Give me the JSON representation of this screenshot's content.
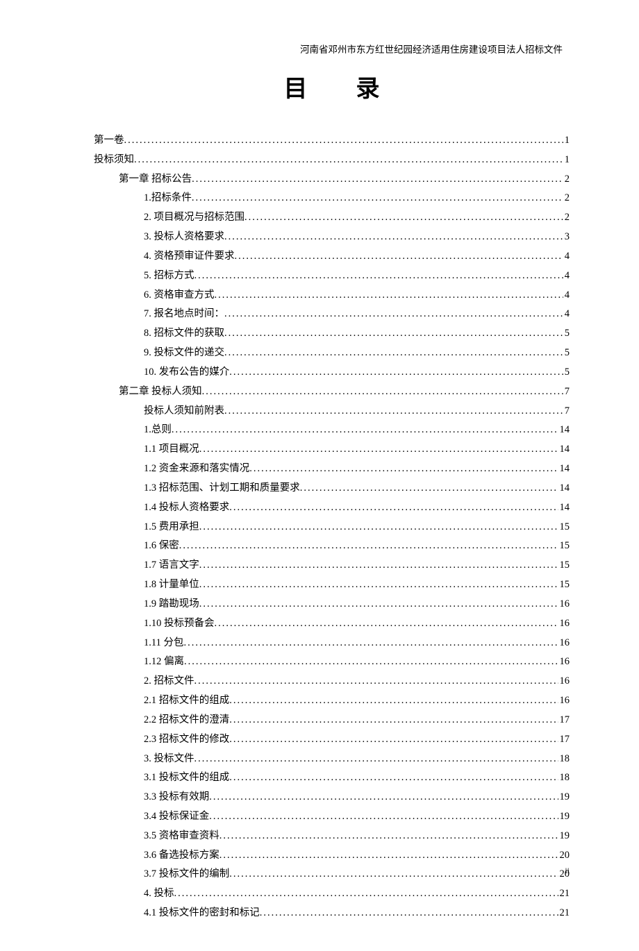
{
  "header": "河南省邓州市东方红世纪园经济适用住房建设项目法人招标文件",
  "title": "目录",
  "footer": "ii",
  "toc": [
    {
      "indent": 0,
      "label": "第一卷",
      "page": "1"
    },
    {
      "indent": 0,
      "label": "投标须知",
      "page": "1"
    },
    {
      "indent": 1,
      "label": "第一章 招标公告",
      "page": "2"
    },
    {
      "indent": 2,
      "label": "1.招标条件",
      "page": "2"
    },
    {
      "indent": 2,
      "label": "2. 项目概况与招标范围",
      "page": "2"
    },
    {
      "indent": 2,
      "label": "3. 投标人资格要求",
      "page": "3"
    },
    {
      "indent": 2,
      "label": "4. 资格预审证件要求",
      "page": "4"
    },
    {
      "indent": 2,
      "label": "5. 招标方式",
      "page": "4"
    },
    {
      "indent": 2,
      "label": "6. 资格审查方式",
      "page": "4"
    },
    {
      "indent": 2,
      "label": "7. 报名地点时间：",
      "page": "4"
    },
    {
      "indent": 2,
      "label": "8. 招标文件的获取",
      "page": "5"
    },
    {
      "indent": 2,
      "label": "9. 投标文件的递交",
      "page": "5"
    },
    {
      "indent": 2,
      "label": "10. 发布公告的媒介",
      "page": "5"
    },
    {
      "indent": 1,
      "label": "第二章 投标人须知",
      "page": "7"
    },
    {
      "indent": 2,
      "label": "投标人须知前附表",
      "page": "7"
    },
    {
      "indent": 2,
      "label": "1.总则",
      "page": "14"
    },
    {
      "indent": 2,
      "label": "1.1 项目概况",
      "page": "14"
    },
    {
      "indent": 2,
      "label": "1.2 资金来源和落实情况",
      "page": "14"
    },
    {
      "indent": 2,
      "label": "1.3 招标范围、计划工期和质量要求",
      "page": "14"
    },
    {
      "indent": 2,
      "label": "1.4 投标人资格要求",
      "page": "14"
    },
    {
      "indent": 2,
      "label": "1.5 费用承担",
      "page": "15"
    },
    {
      "indent": 2,
      "label": "1.6 保密",
      "page": "15"
    },
    {
      "indent": 2,
      "label": "1.7 语言文字",
      "page": "15"
    },
    {
      "indent": 2,
      "label": "1.8 计量单位",
      "page": "15"
    },
    {
      "indent": 2,
      "label": "1.9 踏勘现场",
      "page": "16"
    },
    {
      "indent": 2,
      "label": "1.10 投标预备会",
      "page": "16"
    },
    {
      "indent": 2,
      "label": "1.11 分包",
      "page": "16"
    },
    {
      "indent": 2,
      "label": "1.12 偏离",
      "page": "16"
    },
    {
      "indent": 2,
      "label": "2. 招标文件",
      "page": "16"
    },
    {
      "indent": 2,
      "label": "2.1 招标文件的组成",
      "page": "16"
    },
    {
      "indent": 2,
      "label": "2.2 招标文件的澄清",
      "page": "17"
    },
    {
      "indent": 2,
      "label": "2.3 招标文件的修改",
      "page": "17"
    },
    {
      "indent": 2,
      "label": "3. 投标文件",
      "page": "18"
    },
    {
      "indent": 2,
      "label": "3.1 投标文件的组成",
      "page": "18"
    },
    {
      "indent": 2,
      "label": "3.3 投标有效期",
      "page": "19"
    },
    {
      "indent": 2,
      "label": "3.4 投标保证金",
      "page": "19"
    },
    {
      "indent": 2,
      "label": "3.5 资格审查资料",
      "page": "19"
    },
    {
      "indent": 2,
      "label": "3.6 备选投标方案",
      "page": "20"
    },
    {
      "indent": 2,
      "label": "3.7 投标文件的编制",
      "page": "20"
    },
    {
      "indent": 2,
      "label": "4. 投标",
      "page": "21"
    },
    {
      "indent": 2,
      "label": "4.1 投标文件的密封和标记",
      "page": "21"
    }
  ]
}
